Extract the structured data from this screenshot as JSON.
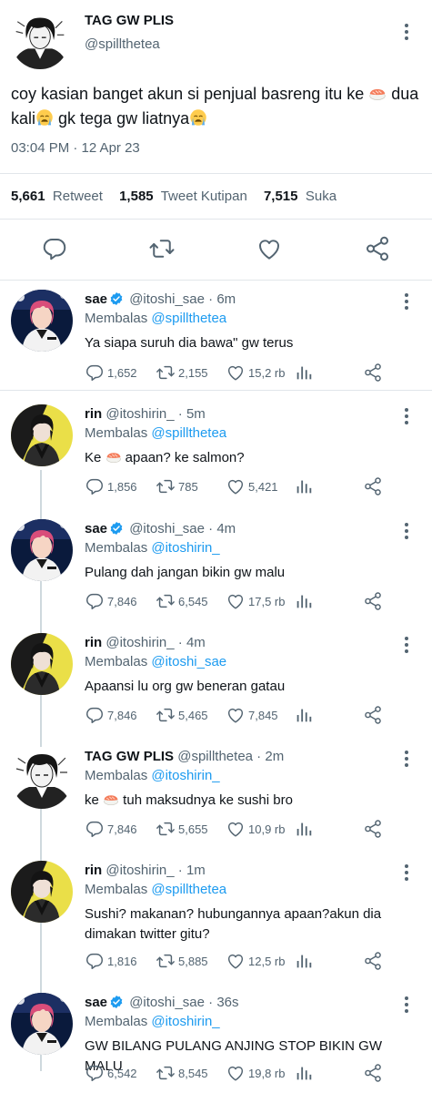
{
  "main_tweet": {
    "display_name": "TAG GW PLIS",
    "handle": "@spillthetea",
    "text_part1": "coy kasian banget akun si penjual basreng itu ke ",
    "text_part2": " dua kali",
    "text_part3": " gk tega gw liatnya",
    "timestamp": "03:04 PM · 12 Apr 23",
    "retweets_count": "5,661",
    "retweets_label": "Retweet",
    "quotes_count": "1,585",
    "quotes_label": "Tweet Kutipan",
    "likes_count": "7,515",
    "likes_label": "Suka"
  },
  "replies": [
    {
      "name": "sae",
      "verified": true,
      "handle": "@itoshi_sae",
      "time": "6m",
      "replying_prefix": "Membalas",
      "replying_to": "@spillthetea",
      "text": "Ya siapa suruh dia bawa\" gw terus",
      "replies": "1,652",
      "retweets": "2,155",
      "likes": "15,2 rb",
      "avatar": "sae"
    },
    {
      "name": "rin",
      "verified": false,
      "handle": "@itoshirin_",
      "time": "5m",
      "replying_prefix": "Membalas",
      "replying_to": "@spillthetea",
      "text_before": "Ke ",
      "text_after": " apaan? ke salmon?",
      "replies": "1,856",
      "retweets": "785",
      "likes": "5,421",
      "avatar": "rin"
    },
    {
      "name": "sae",
      "verified": true,
      "handle": "@itoshi_sae",
      "time": "4m",
      "replying_prefix": "Membalas",
      "replying_to": "@itoshirin_",
      "text": "Pulang dah jangan bikin gw malu",
      "replies": "7,846",
      "retweets": "6,545",
      "likes": "17,5 rb",
      "avatar": "sae"
    },
    {
      "name": "rin",
      "verified": false,
      "handle": "@itoshirin_",
      "time": "4m",
      "replying_prefix": "Membalas",
      "replying_to": "@itoshi_sae",
      "text": "Apaansi lu org gw beneran gatau",
      "replies": "7,846",
      "retweets": "5,465",
      "likes": "7,845",
      "avatar": "rin"
    },
    {
      "name": "TAG GW PLIS",
      "verified": false,
      "handle": "@spillthetea",
      "time": "2m",
      "replying_prefix": "Membalas",
      "replying_to": "@itoshirin_",
      "text_before": "ke ",
      "text_after": " tuh maksudnya ke sushi bro",
      "replies": "7,846",
      "retweets": "5,655",
      "likes": "10,9 rb",
      "avatar": "tag"
    },
    {
      "name": "rin",
      "verified": false,
      "handle": "@itoshirin_",
      "time": "1m",
      "replying_prefix": "Membalas",
      "replying_to": "@spillthetea",
      "text": "Sushi? makanan? hubungannya apaan?akun dia dimakan twitter gitu?",
      "replies": "1,816",
      "retweets": "5,885",
      "likes": "12,5 rb",
      "avatar": "rin"
    },
    {
      "name": "sae",
      "verified": true,
      "handle": "@itoshi_sae",
      "time": "36s",
      "replying_prefix": "Membalas",
      "replying_to": "@itoshirin_",
      "text": "GW BILANG PULANG ANJING STOP BIKIN GW MALU",
      "replies": "6,542",
      "retweets": "8,545",
      "likes": "19,8 rb",
      "avatar": "sae"
    }
  ],
  "colors": {
    "text_primary": "#0f1419",
    "text_secondary": "#536471",
    "link": "#1d9bf0",
    "verified": "#1d9bf0",
    "divider": "#e1e6ea"
  },
  "icons": [
    "sushi-emoji",
    "crying-emoji",
    "verified-badge-icon",
    "reply-icon",
    "retweet-icon",
    "like-icon",
    "analytics-icon",
    "share-icon",
    "more-options-icon"
  ]
}
